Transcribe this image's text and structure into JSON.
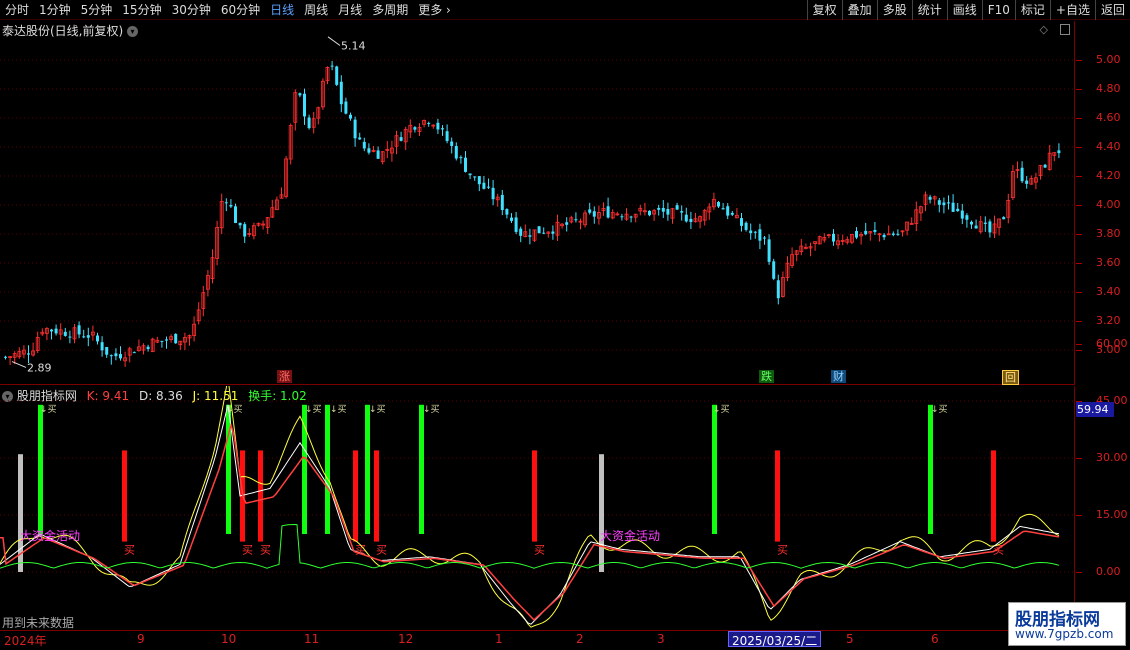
{
  "toolbar": {
    "timeframes": [
      "分时",
      "1分钟",
      "5分钟",
      "15分钟",
      "30分钟",
      "60分钟",
      "日线",
      "周线",
      "月线",
      "多周期",
      "更多"
    ],
    "active": "日线",
    "tools": [
      "复权",
      "叠加",
      "多股",
      "统计",
      "画线",
      "F10",
      "标记",
      "+自选",
      "返回"
    ]
  },
  "main": {
    "title": "泰达股份(日线,前复权)",
    "high_label": "5.14",
    "low_label": "2.89",
    "y_labels": [
      "5.00",
      "4.80",
      "4.60",
      "4.40",
      "4.20",
      "4.00",
      "3.80",
      "3.60",
      "3.40",
      "3.20",
      "3.00"
    ],
    "y_values": [
      5.0,
      4.8,
      4.6,
      4.4,
      4.2,
      4.0,
      3.8,
      3.6,
      3.4,
      3.2,
      3.0
    ],
    "markers": [
      {
        "text": "涨",
        "color": "#ff4040"
      },
      {
        "text": "跌",
        "color": "#30ff30"
      },
      {
        "text": "财",
        "color": "#40c0ff"
      },
      {
        "text": "回",
        "color": "#ffcc40"
      }
    ],
    "up_color": "#ff3030",
    "down_color": "#40e0ff"
  },
  "indicator": {
    "name": "股朋指标网",
    "k_label": "K: 9.41",
    "d_label": "D: 8.36",
    "j_label": "J: 11.51",
    "hs_label": "换手: 1.02",
    "current_value": "59.94",
    "y_labels": [
      "60.00",
      "45.00",
      "30.00",
      "15.00",
      "0.00"
    ],
    "y_values": [
      60,
      45,
      30,
      15,
      0
    ],
    "big_money_text": "大资金活动",
    "buy_text": "买",
    "signal_text": "↓买",
    "colors": {
      "k": "#ffffff",
      "d": "#ffff40",
      "j": "#ff4040",
      "turnover": "#30ff30",
      "sell_bar": "#ff1010",
      "buy_bar": "#10ff10",
      "big_bar": "#c0c0c0"
    }
  },
  "xaxis": {
    "labels": [
      "2024年",
      "9",
      "10",
      "11",
      "12",
      "1",
      "2",
      "3",
      "2025/03/25/二",
      "5",
      "6"
    ]
  },
  "footer": {
    "future_text": "用到未来数据"
  },
  "watermark": {
    "title": "股朋指标网",
    "url": "www.7gpzb.com"
  }
}
